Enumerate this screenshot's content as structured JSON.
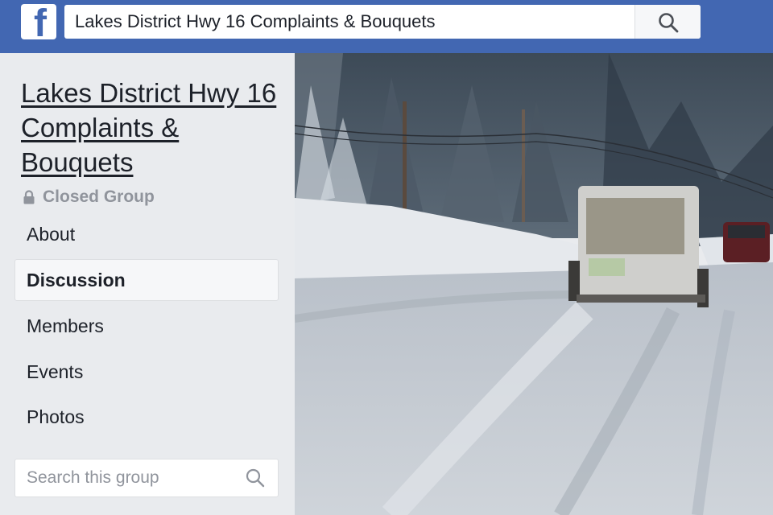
{
  "topbar": {
    "logo_icon": "facebook-f-icon",
    "search_value": "Lakes District Hwy 16 Complaints & Bouquets",
    "search_icon": "search-icon",
    "brand_color": "#4267b2"
  },
  "group": {
    "title": "Lakes District Hwy 16 Complaints & Bouquets",
    "privacy_icon": "lock-icon",
    "privacy_label": "Closed Group"
  },
  "nav": {
    "items": [
      {
        "label": "About",
        "active": false
      },
      {
        "label": "Discussion",
        "active": true
      },
      {
        "label": "Members",
        "active": false
      },
      {
        "label": "Events",
        "active": false
      },
      {
        "label": "Photos",
        "active": false
      }
    ]
  },
  "group_search": {
    "placeholder": "Search this group",
    "icon": "search-icon"
  },
  "cover_photo": {
    "description": "snowy highway"
  }
}
